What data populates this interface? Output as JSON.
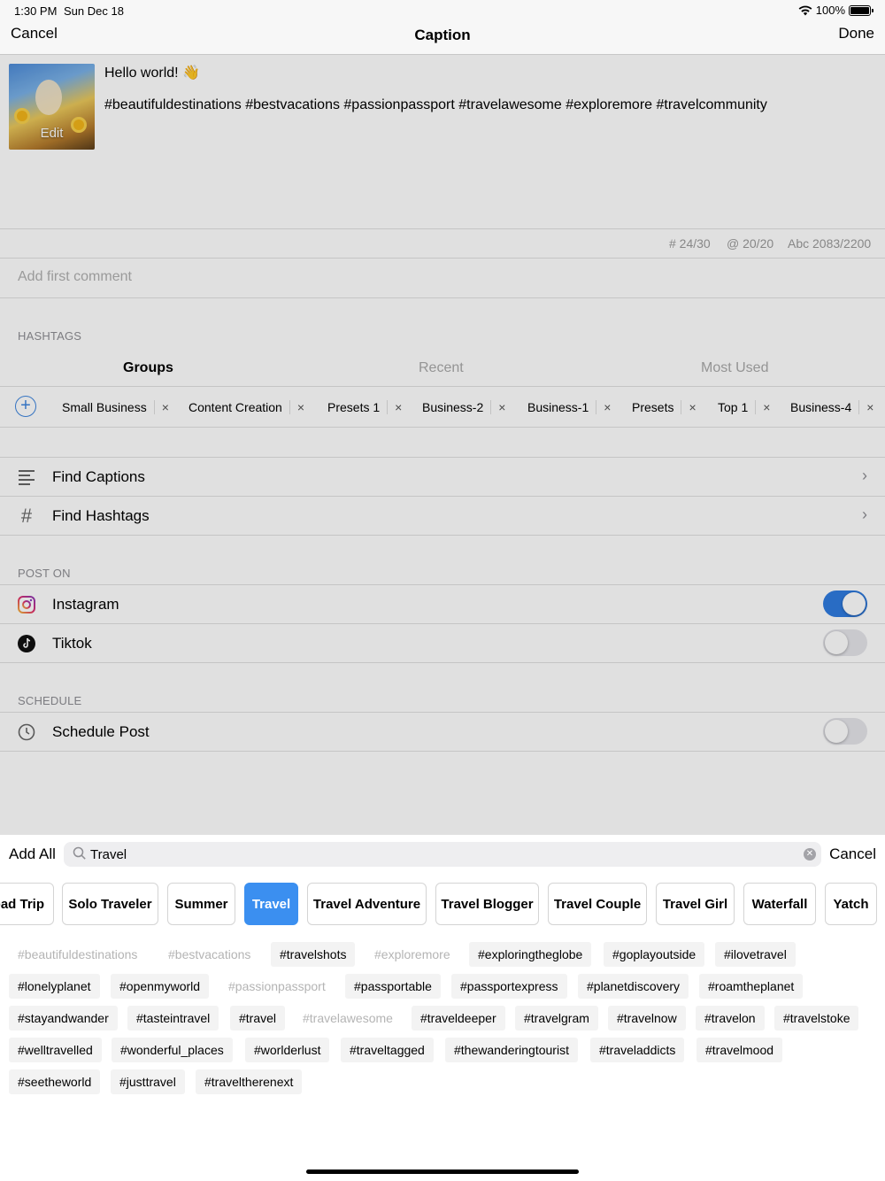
{
  "status": {
    "time": "1:30 PM",
    "date": "Sun Dec 18",
    "battery": "100%"
  },
  "nav": {
    "cancel": "Cancel",
    "title": "Caption",
    "done": "Done"
  },
  "post": {
    "edit_label": "Edit",
    "caption_line1": "Hello world! 👋",
    "caption_line2": "#beautifuldestinations #bestvacations #passionpassport #travelawesome #exploremore #travelcommunity",
    "counters": {
      "hashtags": "# 24/30",
      "mentions": "@ 20/20",
      "chars": "Abc 2083/2200"
    },
    "first_comment_placeholder": "Add first comment"
  },
  "hashtags_section": {
    "label": "HASHTAGS",
    "segments": [
      "Groups",
      "Recent",
      "Most Used"
    ],
    "groups": [
      "Small Business",
      "Content Creation",
      "Presets 1",
      "Business-2",
      "Business-1",
      "Presets",
      "Top 1",
      "Business-4"
    ],
    "close_glyph": "×"
  },
  "tools": {
    "find_captions": "Find Captions",
    "find_hashtags": "Find Hashtags",
    "chevron": "›"
  },
  "post_on": {
    "label": "POST ON",
    "instagram": "Instagram",
    "tiktok": "Tiktok",
    "instagram_on": true,
    "tiktok_on": false
  },
  "schedule": {
    "label": "SCHEDULE",
    "schedule_post": "Schedule Post",
    "on": false
  },
  "picker": {
    "add_all": "Add All",
    "search_value": "Travel",
    "cancel": "Cancel",
    "categories": [
      "Road Trip",
      "Solo Traveler",
      "Summer",
      "Travel",
      "Travel Adventure",
      "Travel Blogger",
      "Travel Couple",
      "Travel Girl",
      "Waterfall",
      "Yatch"
    ],
    "active_category": "Travel",
    "tags": [
      {
        "t": "#beautifuldestinations",
        "dim": true
      },
      {
        "t": "#bestvacations",
        "dim": true
      },
      {
        "t": "#travelshots",
        "dim": false
      },
      {
        "t": "#exploremore",
        "dim": true
      },
      {
        "t": "#exploringtheglobe",
        "dim": false
      },
      {
        "t": "#goplayoutside",
        "dim": false
      },
      {
        "t": "#ilovetravel",
        "dim": false
      },
      {
        "t": "#lonelyplanet",
        "dim": false
      },
      {
        "t": "#openmyworld",
        "dim": false
      },
      {
        "t": "#passionpassport",
        "dim": true
      },
      {
        "t": "#passportable",
        "dim": false
      },
      {
        "t": "#passportexpress",
        "dim": false
      },
      {
        "t": "#planetdiscovery",
        "dim": false
      },
      {
        "t": "#roamtheplanet",
        "dim": false
      },
      {
        "t": "#stayandwander",
        "dim": false
      },
      {
        "t": "#tasteintravel",
        "dim": false
      },
      {
        "t": "#travel",
        "dim": false
      },
      {
        "t": "#travelawesome",
        "dim": true
      },
      {
        "t": "#traveldeeper",
        "dim": false
      },
      {
        "t": "#travelgram",
        "dim": false
      },
      {
        "t": "#travelnow",
        "dim": false
      },
      {
        "t": "#travelon",
        "dim": false
      },
      {
        "t": "#travelstoke",
        "dim": false
      },
      {
        "t": "#welltravelled",
        "dim": false
      },
      {
        "t": "#wonderful_places",
        "dim": false
      },
      {
        "t": "#worlderlust",
        "dim": false
      },
      {
        "t": "#traveltagged",
        "dim": false
      },
      {
        "t": "#thewanderingtourist",
        "dim": false
      },
      {
        "t": "#traveladdicts",
        "dim": false
      },
      {
        "t": "#travelmood",
        "dim": false
      },
      {
        "t": "#seetheworld",
        "dim": false
      },
      {
        "t": "#justtravel",
        "dim": false
      },
      {
        "t": "#traveltherenext",
        "dim": false
      }
    ]
  },
  "colors": {
    "accent": "#3b8ff0",
    "toggle_on": "#2f7be0",
    "dim_text": "#b4b4b4"
  }
}
